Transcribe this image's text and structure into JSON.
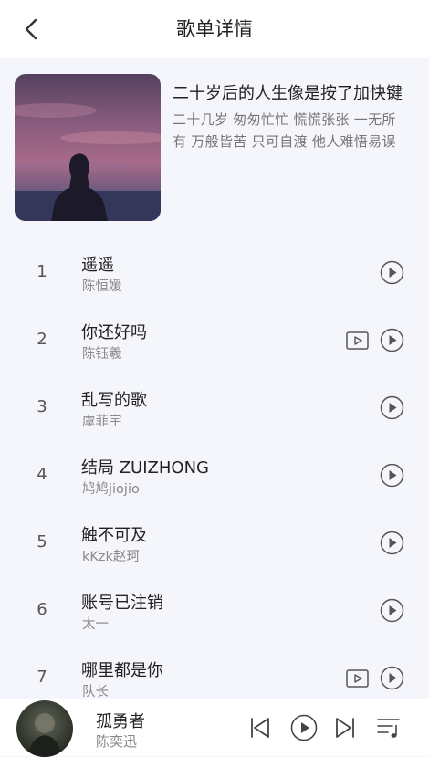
{
  "header": {
    "title": "歌单详情"
  },
  "playlist": {
    "name": "二十岁后的人生像是按了加快键",
    "description_lines": [
      "二十几岁 匆匆忙忙 慌慌张张 一无所",
      "有 万般皆苦 只可自渡 他人难悟易误"
    ]
  },
  "tracks": [
    {
      "num": "1",
      "name": "遥遥",
      "artist": "陈恒媛",
      "has_mv": false
    },
    {
      "num": "2",
      "name": "你还好吗",
      "artist": "陈钰羲",
      "has_mv": true
    },
    {
      "num": "3",
      "name": "乱写的歌",
      "artist": "虞菲宇",
      "has_mv": false
    },
    {
      "num": "4",
      "name": "结局 ZUIZHONG",
      "artist": "鸠鸠jiojio",
      "has_mv": false
    },
    {
      "num": "5",
      "name": "触不可及",
      "artist": "kKzk赵珂",
      "has_mv": false
    },
    {
      "num": "6",
      "name": "账号已注销",
      "artist": "太一",
      "has_mv": false
    },
    {
      "num": "7",
      "name": "哪里都是你",
      "artist": "队长",
      "has_mv": true
    }
  ],
  "player": {
    "song": "孤勇者",
    "artist": "陈奕迅"
  }
}
